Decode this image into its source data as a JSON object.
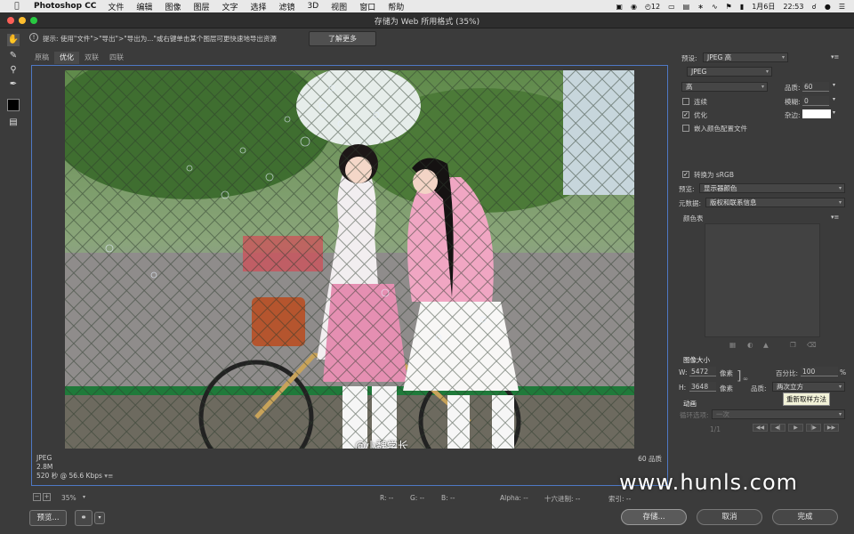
{
  "menubar": {
    "app_name": "Photoshop CC",
    "items": [
      "文件",
      "编辑",
      "图像",
      "图层",
      "文字",
      "选择",
      "滤镜",
      "3D",
      "视图",
      "窗口",
      "帮助"
    ],
    "status_num": "12",
    "date": "1月6日",
    "time": "22:53"
  },
  "window": {
    "title": "存储为 Web 所用格式 (35%)"
  },
  "hint": {
    "text": "提示: 使用\"文件\">\"导出\">\"导出为...\"或右键单击某个图层可更快速地导出资源",
    "learn_more": "了解更多"
  },
  "tabs": [
    {
      "label": "原稿"
    },
    {
      "label": "优化"
    },
    {
      "label": "双联"
    },
    {
      "label": "四联"
    }
  ],
  "preview": {
    "format": "JPEG",
    "size": "2.8M",
    "speed": "520 秒 @ 56.6 Kbps",
    "quality_label": "60 品质",
    "photo_watermark": "@小魏学长"
  },
  "statusbar": {
    "zoom": "35%",
    "r": "R: --",
    "g": "G: --",
    "b": "B: --",
    "alpha": "Alpha: --",
    "hex": "十六进制: --",
    "index": "索引: --"
  },
  "bottom_buttons": {
    "preview": "预览...",
    "save": "存储...",
    "cancel": "取消",
    "done": "完成"
  },
  "settings": {
    "preset_label": "预设:",
    "preset_value": "JPEG 高",
    "format_value": "JPEG",
    "quality_level": "高",
    "quality_label": "品质:",
    "quality_value": "60",
    "progressive_label": "连续",
    "blur_label": "模糊:",
    "blur_value": "0",
    "optimized_label": "优化",
    "matte_label": "杂边:",
    "embed_profile_label": "嵌入颜色配置文件",
    "convert_srgb_label": "转换为 sRGB",
    "preview_label": "预览:",
    "preview_value": "显示器颜色",
    "metadata_label": "元数据:",
    "metadata_value": "版权和联系信息",
    "color_table_label": "颜色表"
  },
  "image_size": {
    "title": "图像大小",
    "w_label": "W:",
    "w_value": "5472",
    "h_label": "H:",
    "h_value": "3648",
    "unit": "像素",
    "percent_label": "百分比:",
    "percent_value": "100",
    "percent_unit": "%",
    "quality_label": "品质:",
    "quality_value": "两次立方",
    "tooltip": "重新取样方法"
  },
  "animation": {
    "title": "动画",
    "loop_label": "循环选项:",
    "loop_value": "一次",
    "frame": "1/1"
  },
  "site_watermark": "www.hunls.com",
  "colors": {
    "selection_border": "#4e78c4",
    "panel_bg": "#3b3b3b",
    "menubar_bg": "#e9e9e9"
  }
}
